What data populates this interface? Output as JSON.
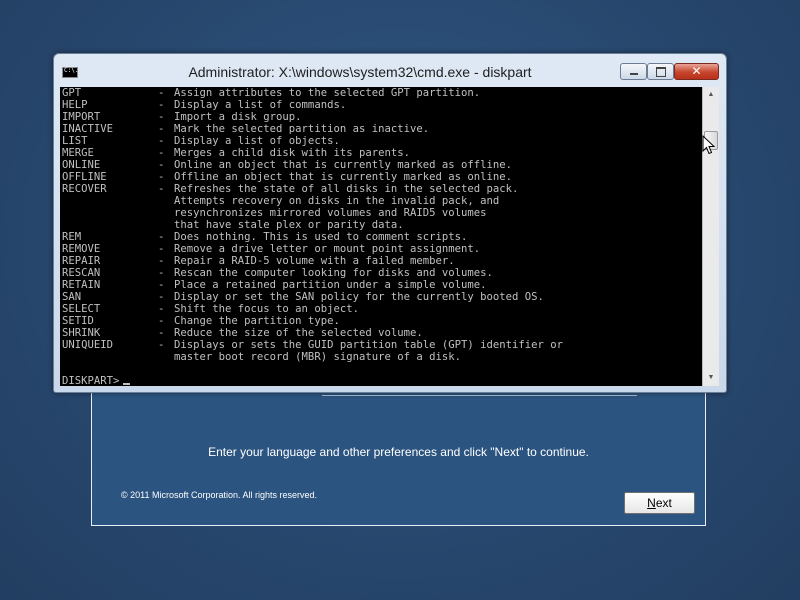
{
  "window": {
    "title": "Administrator: X:\\windows\\system32\\cmd.exe - diskpart",
    "icon_label": "C:\\.",
    "icon": "cmd-icon",
    "min_icon": "minimize-icon",
    "max_icon": "maximize-icon",
    "close_icon": "close-icon",
    "close_glyph": "✕"
  },
  "console": {
    "commands": [
      {
        "name": "GPT",
        "desc": "Assign attributes to the selected GPT partition."
      },
      {
        "name": "HELP",
        "desc": "Display a list of commands."
      },
      {
        "name": "IMPORT",
        "desc": "Import a disk group."
      },
      {
        "name": "INACTIVE",
        "desc": "Mark the selected partition as inactive."
      },
      {
        "name": "LIST",
        "desc": "Display a list of objects."
      },
      {
        "name": "MERGE",
        "desc": "Merges a child disk with its parents."
      },
      {
        "name": "ONLINE",
        "desc": "Online an object that is currently marked as offline."
      },
      {
        "name": "OFFLINE",
        "desc": "Offline an object that is currently marked as online."
      },
      {
        "name": "RECOVER",
        "desc": "Refreshes the state of all disks in the selected pack."
      },
      {
        "name": "",
        "desc": "Attempts recovery on disks in the invalid pack, and"
      },
      {
        "name": "",
        "desc": "resynchronizes mirrored volumes and RAID5 volumes"
      },
      {
        "name": "",
        "desc": "that have stale plex or parity data."
      },
      {
        "name": "REM",
        "desc": "Does nothing. This is used to comment scripts."
      },
      {
        "name": "REMOVE",
        "desc": "Remove a drive letter or mount point assignment."
      },
      {
        "name": "REPAIR",
        "desc": "Repair a RAID-5 volume with a failed member."
      },
      {
        "name": "RESCAN",
        "desc": "Rescan the computer looking for disks and volumes."
      },
      {
        "name": "RETAIN",
        "desc": "Place a retained partition under a simple volume."
      },
      {
        "name": "SAN",
        "desc": "Display or set the SAN policy for the currently booted OS."
      },
      {
        "name": "SELECT",
        "desc": "Shift the focus to an object."
      },
      {
        "name": "SETID",
        "desc": "Change the partition type."
      },
      {
        "name": "SHRINK",
        "desc": "Reduce the size of the selected volume."
      },
      {
        "name": "UNIQUEID",
        "desc": "Displays or sets the GUID partition table (GPT) identifier or"
      },
      {
        "name": "",
        "desc": "master boot record (MBR) signature of a disk."
      }
    ],
    "dash": "-",
    "prompt": "DISKPART>"
  },
  "scrollbar": {
    "up_arrow": "▲",
    "down_arrow": "▼"
  },
  "setup": {
    "message": "Enter your language and other preferences and click \"Next\" to continue.",
    "copyright": "© 2011 Microsoft Corporation. All rights reserved.",
    "next_label_underlined": "N",
    "next_label_rest": "ext"
  },
  "colors": {
    "desktop": "#2a4d75",
    "console_bg": "#000000",
    "console_fg": "#c0c0c0",
    "close_button": "#c6452d"
  }
}
